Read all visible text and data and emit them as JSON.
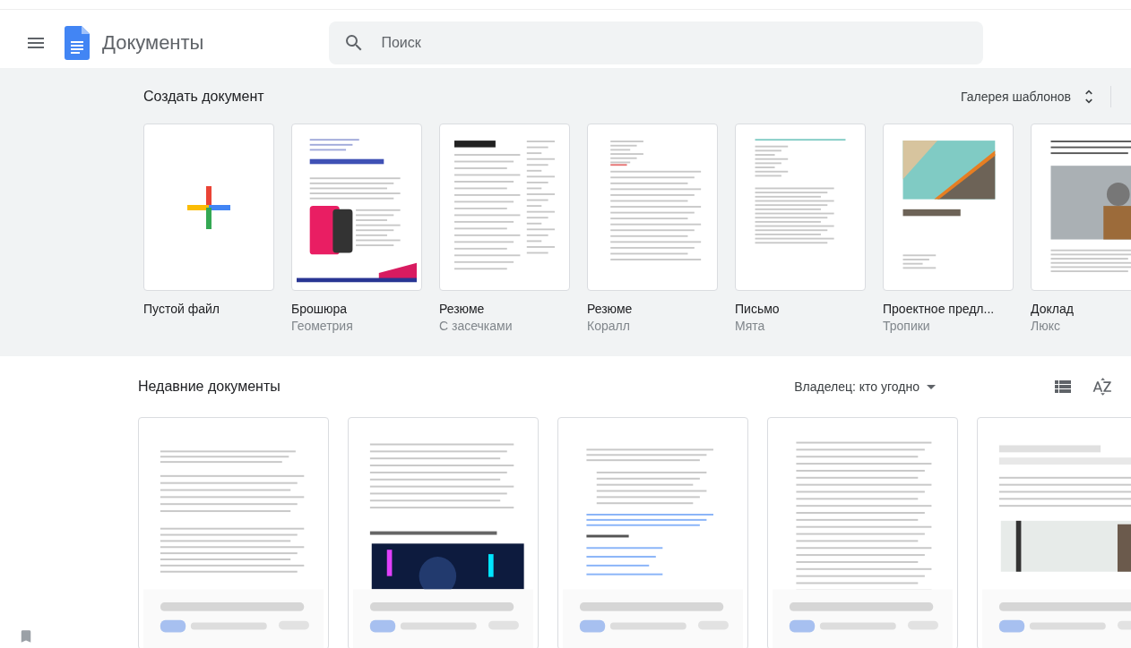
{
  "app": {
    "title": "Документы"
  },
  "search": {
    "placeholder": "Поиск"
  },
  "templates_section": {
    "title": "Создать документ",
    "gallery_label": "Галерея шаблонов",
    "templates": [
      {
        "kind": "blank",
        "name": "Пустой файл"
      },
      {
        "kind": "picture",
        "name": "Брошюра",
        "subtitle": "Геометрия"
      },
      {
        "kind": "picture",
        "name": "Резюме",
        "subtitle": "С засечками"
      },
      {
        "kind": "picture",
        "name": "Резюме",
        "subtitle": "Коралл"
      },
      {
        "kind": "picture",
        "name": "Письмо",
        "subtitle": "Мята"
      },
      {
        "kind": "picture",
        "name": "Проектное предл...",
        "subtitle": "Тропики"
      },
      {
        "kind": "picture",
        "name": "Доклад",
        "subtitle": "Люкс"
      }
    ]
  },
  "recent_section": {
    "title": "Недавние документы",
    "owner_filter": "Владелец: кто угодно"
  }
}
